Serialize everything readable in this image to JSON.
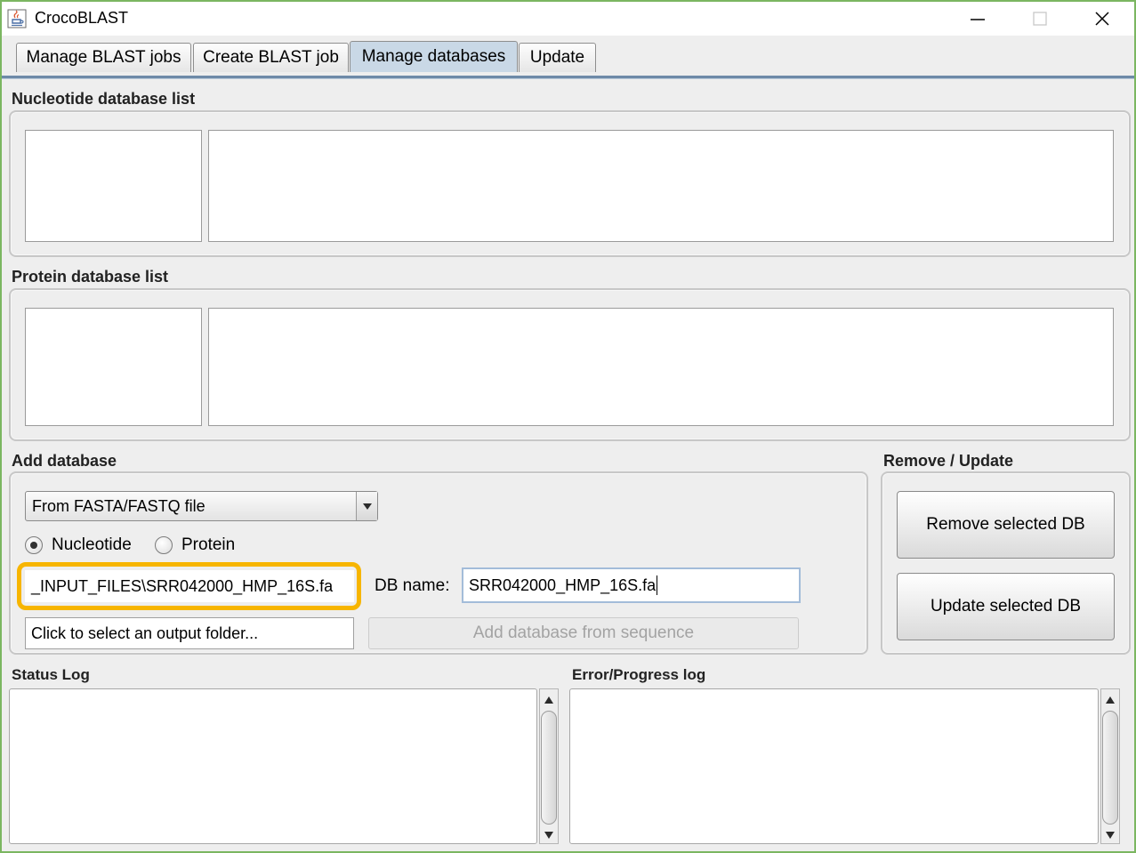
{
  "window": {
    "title": "CrocoBLAST"
  },
  "tabs": [
    {
      "label": "Manage BLAST jobs",
      "active": false
    },
    {
      "label": "Create BLAST job",
      "active": false
    },
    {
      "label": "Manage databases",
      "active": true
    },
    {
      "label": "Update",
      "active": false
    }
  ],
  "nucleotide_section": {
    "title": "Nucleotide database list"
  },
  "protein_section": {
    "title": "Protein database list"
  },
  "add_database": {
    "title": "Add database",
    "source_selected": "From FASTA/FASTQ file",
    "radio_nucleotide": "Nucleotide",
    "radio_protein": "Protein",
    "selected_type": "Nucleotide",
    "input_file_value": "_INPUT_FILES\\SRR042000_HMP_16S.fa",
    "db_name_label": "DB name:",
    "db_name_value": "SRR042000_HMP_16S.fa",
    "output_folder_value": "Click to select an output folder...",
    "add_button_label": "Add database from sequence"
  },
  "remove_update": {
    "title": "Remove / Update",
    "remove_button_label": "Remove selected DB",
    "update_button_label": "Update selected DB"
  },
  "logs": {
    "status_title": "Status Log",
    "error_title": "Error/Progress log"
  },
  "colors": {
    "highlight": "#f7b500",
    "window_border": "#7bb661",
    "active_tab": "#c9d8e6"
  },
  "icons": {
    "app": "java-cup-icon",
    "minimize": "minimize-icon",
    "maximize": "maximize-icon",
    "close": "close-icon"
  }
}
